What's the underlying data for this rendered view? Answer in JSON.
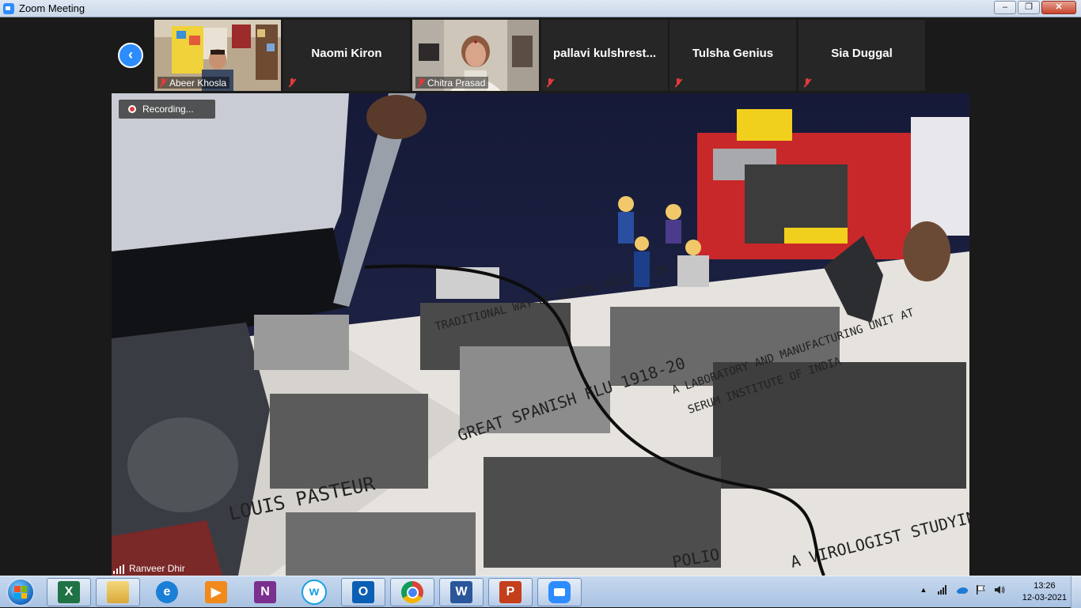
{
  "window": {
    "title": "Zoom Meeting"
  },
  "window_controls": {
    "minimize": "‒",
    "maximize": "❐",
    "close": "✕"
  },
  "participants": [
    {
      "name": "Abeer Khosla",
      "has_video": true,
      "muted": true
    },
    {
      "name": "Naomi Kiron",
      "has_video": false,
      "muted": true
    },
    {
      "name": "Chitra Prasad",
      "has_video": true,
      "muted": true
    },
    {
      "name": "pallavi  kulshrest...",
      "has_video": false,
      "muted": true
    },
    {
      "name": "Tulsha Genius",
      "has_video": false,
      "muted": true
    },
    {
      "name": "Sia Duggal",
      "has_video": false,
      "muted": true
    }
  ],
  "recording": {
    "label": "Recording..."
  },
  "active_speaker": {
    "name": "Ranveer Dhir"
  },
  "taskbar": {
    "apps": [
      {
        "name": "excel",
        "glyph": "X",
        "color": "#1f7244",
        "open": true
      },
      {
        "name": "file-explorer",
        "glyph": "",
        "color": "#e9c35a",
        "open": true
      },
      {
        "name": "internet-explorer",
        "glyph": "e",
        "color": "#1b7fd6",
        "open": false
      },
      {
        "name": "media-player",
        "glyph": "▶",
        "color": "#f08a1c",
        "open": false
      },
      {
        "name": "onenote",
        "glyph": "N",
        "color": "#7b2f8e",
        "open": false
      },
      {
        "name": "webex-app",
        "glyph": "w",
        "color": "#1aa1e0",
        "open": false
      },
      {
        "name": "outlook",
        "glyph": "O",
        "color": "#0a5fb4",
        "open": true
      },
      {
        "name": "chrome",
        "glyph": "",
        "color": "#db4437",
        "open": true
      },
      {
        "name": "word",
        "glyph": "W",
        "color": "#2b579a",
        "open": true
      },
      {
        "name": "powerpoint",
        "glyph": "P",
        "color": "#c43e1c",
        "open": true
      },
      {
        "name": "zoom",
        "glyph": "",
        "color": "#2d8cff",
        "open": true
      }
    ],
    "clock": {
      "time": "13:26",
      "date": "12-03-2021"
    }
  }
}
